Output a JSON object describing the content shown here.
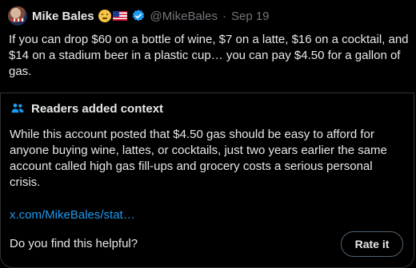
{
  "author": {
    "name": "Mike Bales",
    "handle": "@MikeBales",
    "separator": "·",
    "date": "Sep 19",
    "emoji_icons": [
      "saluting-face-icon",
      "us-flag-icon"
    ],
    "verified_icon": "verified-badge-icon"
  },
  "post": {
    "text": "If you can drop $60 on a bottle of wine, $7 on a latte, $16 on a cocktail, and $14 on a stadium beer in a plastic cup… you can pay $4.50 for a gallon of gas."
  },
  "community_note": {
    "icon": "people-icon",
    "title": "Readers added context",
    "text": "While this account posted that $4.50 gas should be easy to afford for anyone buying wine, lattes, or cocktails, just two years earlier the same account called high gas fill-ups and grocery costs a serious personal crisis.",
    "link_text": "x.com/MikeBales/stat…",
    "question": "Do you find this helpful?",
    "rate_label": "Rate it"
  },
  "colors": {
    "background": "#000000",
    "text": "#e7e9ea",
    "muted": "#71767b",
    "link": "#1d9bf0",
    "border": "#2f3336",
    "verified": "#1d9bf0"
  }
}
